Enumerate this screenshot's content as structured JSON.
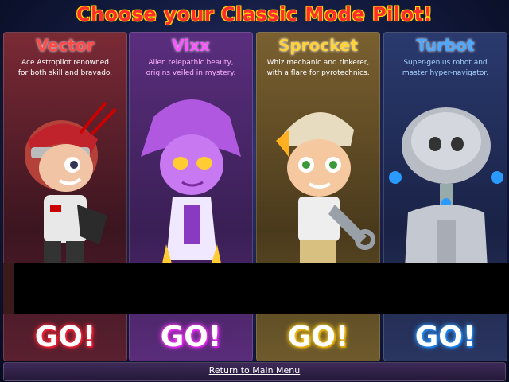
{
  "title": "Choose your Classic Mode Pilot!",
  "pilots": [
    {
      "name": "Vector",
      "desc_line1": "Ace Astropilot renowned",
      "desc_line2": "for both skill and bravado.",
      "go": "GO!",
      "name_color": "#ff3b3b",
      "go_color": "#ff2a3a",
      "bg": "#6a2733"
    },
    {
      "name": "Vixx",
      "desc_line1": "Alien telepathic beauty,",
      "desc_line2": "origins veiled in mystery.",
      "go": "GO!",
      "name_color": "#ff55ff",
      "go_color": "#ff3cff",
      "bg": "#4a2a6e"
    },
    {
      "name": "Sprocket",
      "desc_line1": "Whiz mechanic and tinkerer,",
      "desc_line2": "with a flare for pyrotechnics.",
      "go": "GO!",
      "name_color": "#ffd23a",
      "go_color": "#ffcc22",
      "bg": "#6e5a2c"
    },
    {
      "name": "Turbot",
      "desc_line1": "Super-genius robot and",
      "desc_line2": "master hyper-navigator.",
      "go": "GO!",
      "name_color": "#4aa8ff",
      "go_color": "#2f9bff",
      "bg": "#2a3560"
    }
  ],
  "footer": {
    "return_label": "Return to Main Menu"
  }
}
